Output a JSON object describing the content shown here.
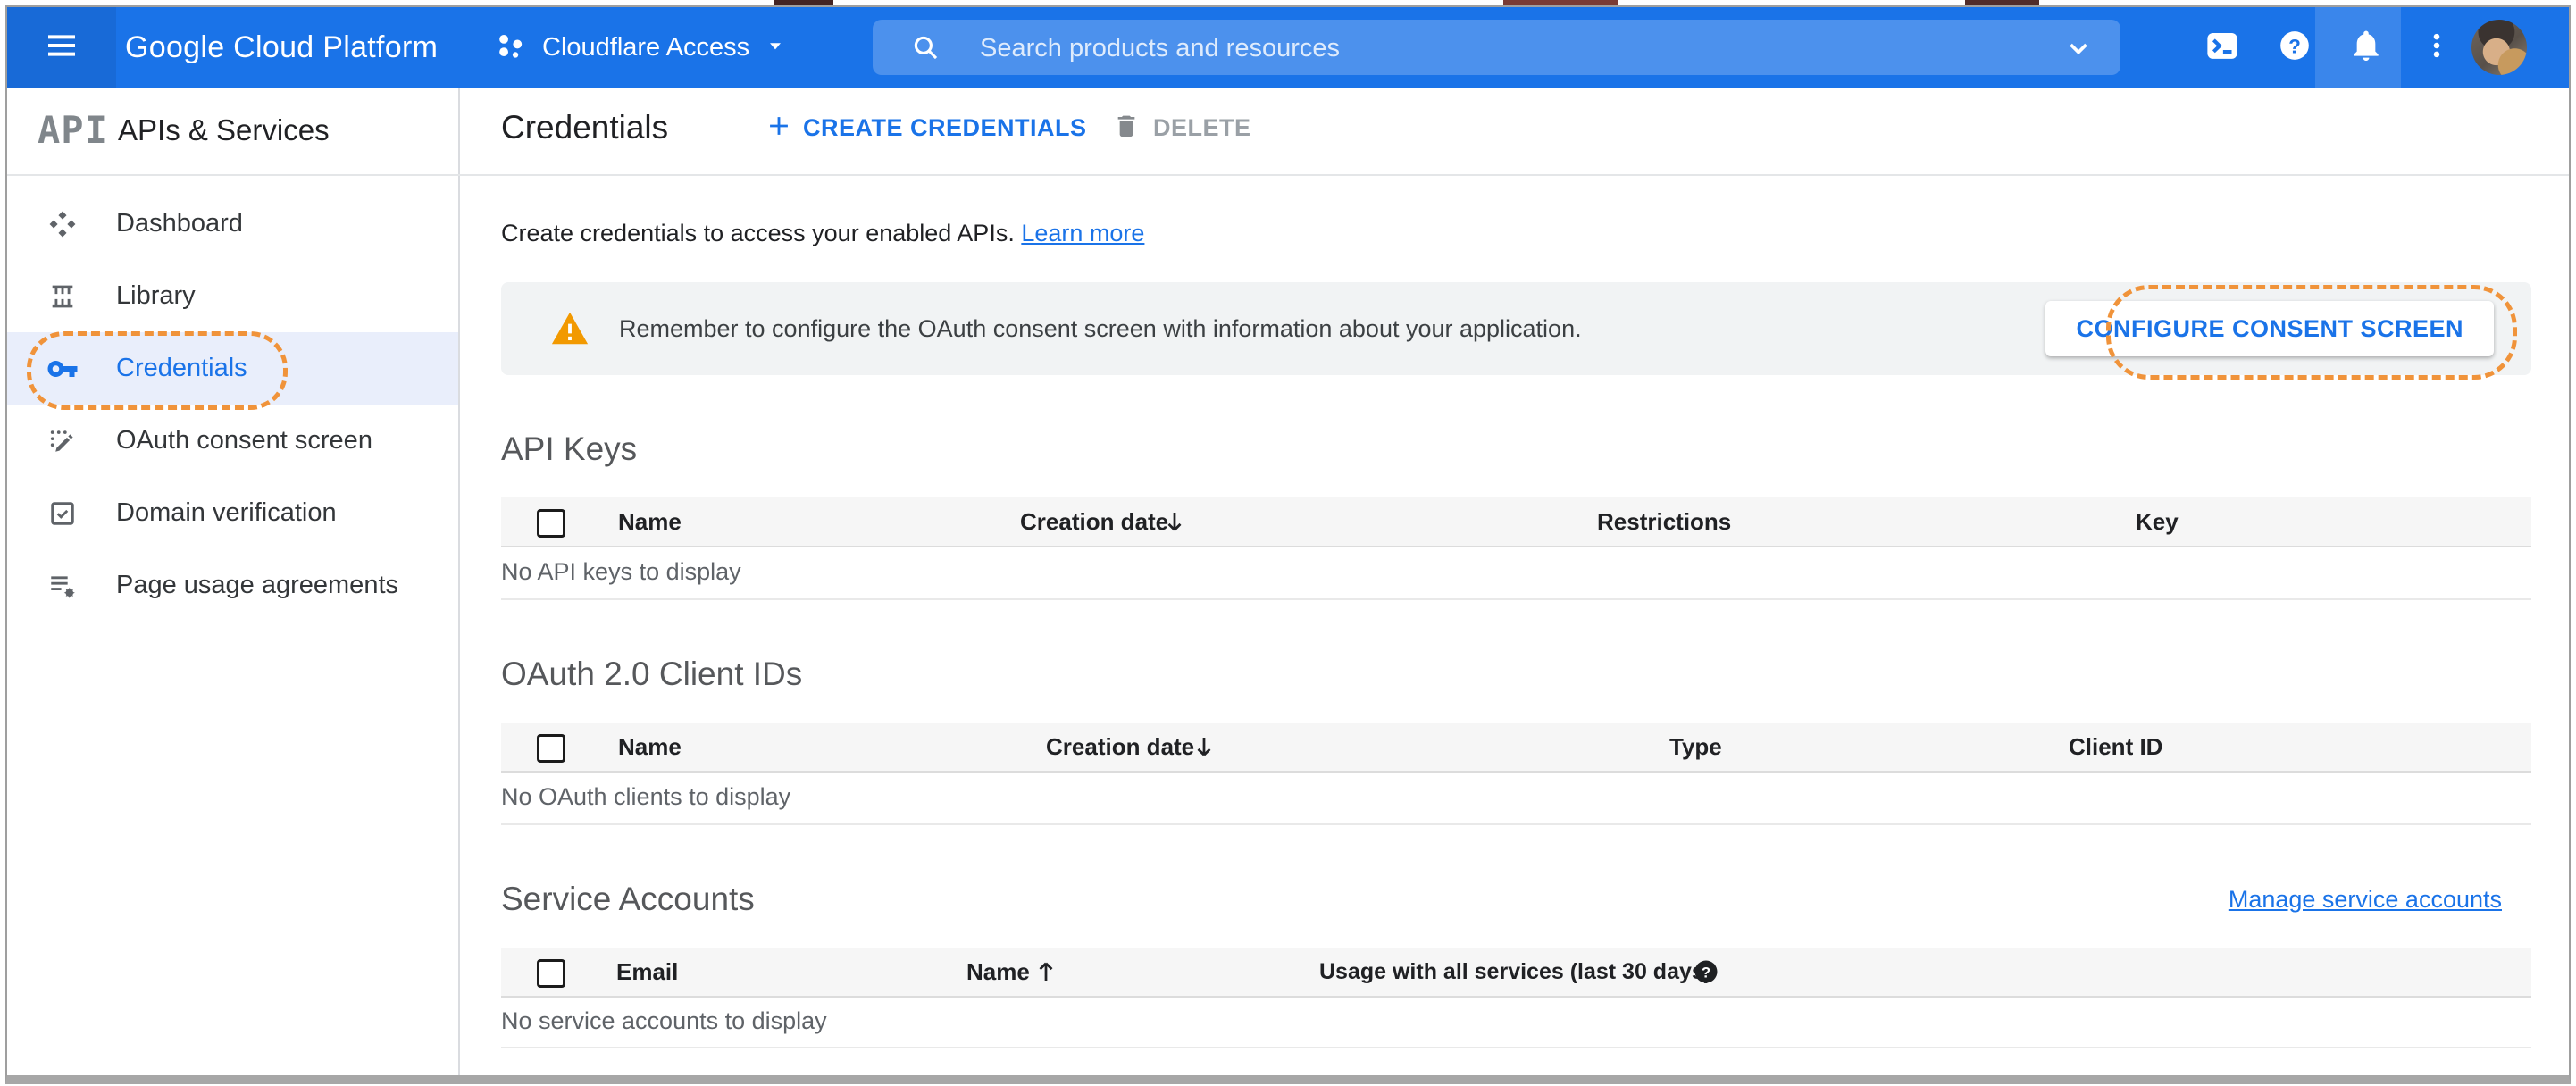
{
  "topbar": {
    "logo": "Google Cloud Platform",
    "project": "Cloudflare Access",
    "search_placeholder": "Search products and resources"
  },
  "sidebar": {
    "product_logo": "API",
    "title": "APIs & Services",
    "items": [
      {
        "label": "Dashboard"
      },
      {
        "label": "Library"
      },
      {
        "label": "Credentials"
      },
      {
        "label": "OAuth consent screen"
      },
      {
        "label": "Domain verification"
      },
      {
        "label": "Page usage agreements"
      }
    ]
  },
  "header": {
    "title": "Credentials",
    "create_label": "CREATE CREDENTIALS",
    "delete_label": "DELETE"
  },
  "main": {
    "intro": "Create credentials to access your enabled APIs.",
    "learn_more": "Learn more",
    "banner": {
      "text": "Remember to configure the OAuth consent screen with information about your application.",
      "button": "CONFIGURE CONSENT SCREEN"
    },
    "api_keys": {
      "title": "API Keys",
      "columns": [
        "Name",
        "Creation date",
        "Restrictions",
        "Key"
      ],
      "sort_column": "Creation date",
      "sort_direction": "desc",
      "empty": "No API keys to display"
    },
    "oauth": {
      "title": "OAuth 2.0 Client IDs",
      "columns": [
        "Name",
        "Creation date",
        "Type",
        "Client ID"
      ],
      "sort_column": "Creation date",
      "sort_direction": "desc",
      "empty": "No OAuth clients to display"
    },
    "service_accounts": {
      "title": "Service Accounts",
      "manage_link": "Manage service accounts",
      "columns": [
        "Email",
        "Name",
        "Usage with all services (last 30 days)"
      ],
      "sort_column": "Name",
      "sort_direction": "asc",
      "empty": "No service accounts to display"
    }
  },
  "colors": {
    "topbar_blue": "#1a73e8",
    "accent_blue": "#1a73e8",
    "annotation_orange": "#f0933a",
    "warning_orange": "#f29900",
    "banner_bg": "#f1f3f4"
  }
}
